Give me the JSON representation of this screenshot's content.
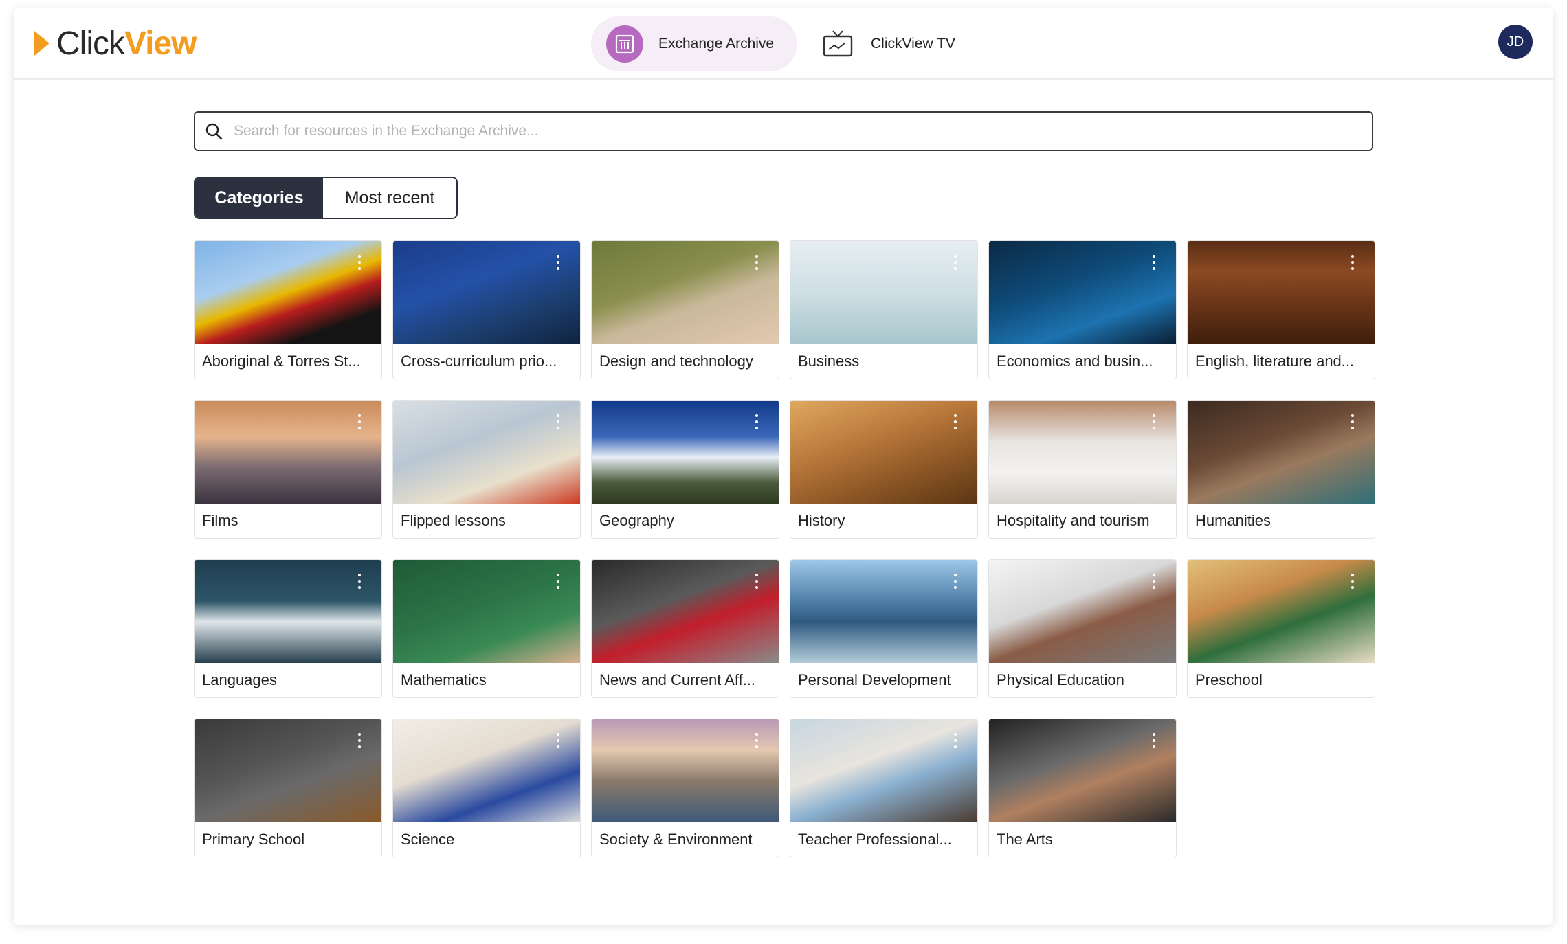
{
  "brand": {
    "click": "Click",
    "view": "View"
  },
  "nav": {
    "exchange_label": "Exchange Archive",
    "tv_label": "ClickView TV"
  },
  "user": {
    "initials": "JD"
  },
  "search": {
    "placeholder": "Search for resources in the Exchange Archive..."
  },
  "tabs": {
    "categories": "Categories",
    "recent": "Most recent"
  },
  "categories": [
    {
      "label": "Aboriginal & Torres St...",
      "bg": "linear-gradient(160deg,#7fb3e6 0%,#a9cdf0 35%,#e8b800 50%,#b81d1d 62%,#141414 80%)"
    },
    {
      "label": "Cross-curriculum prio...",
      "bg": "linear-gradient(160deg,#1a3d8a 0%,#2451a8 40%,#1c3e6e 70%,#0f2340 100%)"
    },
    {
      "label": "Design and technology",
      "bg": "linear-gradient(160deg,#6e7a3a 0%,#8a8f4e 40%,#c9b89a 60%,#e3c9b0 100%)"
    },
    {
      "label": "Business",
      "bg": "linear-gradient(180deg,#e6eef2 0%,#cfdfe4 50%,#a7c5cc 100%)"
    },
    {
      "label": "Economics and busin...",
      "bg": "linear-gradient(160deg,#0b2a45 0%,#0e4a78 40%,#1d73b0 70%,#0a1e33 100%)"
    },
    {
      "label": "English, literature and...",
      "bg": "linear-gradient(180deg,#5a2e16 0%,#8c4a22 30%,#6b3519 60%,#3e1e0c 100%)"
    },
    {
      "label": "Films",
      "bg": "linear-gradient(180deg,#c98a5a 0%,#e6b48c 35%,#7a6a70 65%,#3b3440 100%)"
    },
    {
      "label": "Flipped lessons",
      "bg": "linear-gradient(160deg,#d9dfe4 0%,#b9c6d2 40%,#e8e0cc 70%,#cc3a22 100%)"
    },
    {
      "label": "Geography",
      "bg": "linear-gradient(180deg,#123a8a 0%,#3b66b8 35%,#e7eef5 55%,#4a5a3a 80%,#2e3a22 100%)"
    },
    {
      "label": "History",
      "bg": "linear-gradient(160deg,#e0a860 0%,#b8773a 40%,#8a5524 70%,#5c3614 100%)"
    },
    {
      "label": "Hospitality and tourism",
      "bg": "linear-gradient(180deg,#b78a6a 0%,#e8e4e0 40%,#f4f2f0 70%,#d8d4d0 100%)"
    },
    {
      "label": "Humanities",
      "bg": "linear-gradient(160deg,#3b2a20 0%,#6b4a36 40%,#9a7a5e 60%,#2f6f78 100%)"
    },
    {
      "label": "Languages",
      "bg": "linear-gradient(180deg,#1f3e50 0%,#2d5568 40%,#dfe6ea 60%,#263f4e 100%)"
    },
    {
      "label": "Mathematics",
      "bg": "linear-gradient(160deg,#1f5a38 0%,#2c7447 45%,#3a8a55 70%,#d9b090 100%)"
    },
    {
      "label": "News and Current Aff...",
      "bg": "linear-gradient(160deg,#2a2a2a 0%,#5a5a5a 40%,#c21e2b 60%,#8a8a8a 100%)"
    },
    {
      "label": "Personal Development",
      "bg": "linear-gradient(180deg,#9ec7e8 0%,#4f7fa8 40%,#2f5a80 60%,#b3ccd9 100%)"
    },
    {
      "label": "Physical Education",
      "bg": "linear-gradient(160deg,#f4f4f4 0%,#d8d8d8 40%,#8a5c46 60%,#7a7a7a 100%)"
    },
    {
      "label": "Preschool",
      "bg": "linear-gradient(160deg,#e3c07a 0%,#c78a4a 35%,#2f6e3c 60%,#e8dcc4 100%)"
    },
    {
      "label": "Primary School",
      "bg": "linear-gradient(160deg,#3a3a3a 0%,#555555 40%,#6a6a6a 60%,#8a5a2a 100%)"
    },
    {
      "label": "Science",
      "bg": "linear-gradient(160deg,#f2ede6 0%,#e4dcd0 40%,#2a4aa0 70%,#dcdcdc 100%)"
    },
    {
      "label": "Society & Environment",
      "bg": "linear-gradient(180deg,#b99ab6 0%,#e4c8b0 30%,#8a7a6a 60%,#3e5a78 100%)"
    },
    {
      "label": "Teacher Professional...",
      "bg": "linear-gradient(160deg,#c7d6e0 0%,#e8e4de 40%,#8ab0d0 60%,#4a3a30 100%)"
    },
    {
      "label": "The Arts",
      "bg": "linear-gradient(160deg,#222222 0%,#6a6a6a 40%,#b08060 60%,#2a2a2a 100%)"
    }
  ]
}
